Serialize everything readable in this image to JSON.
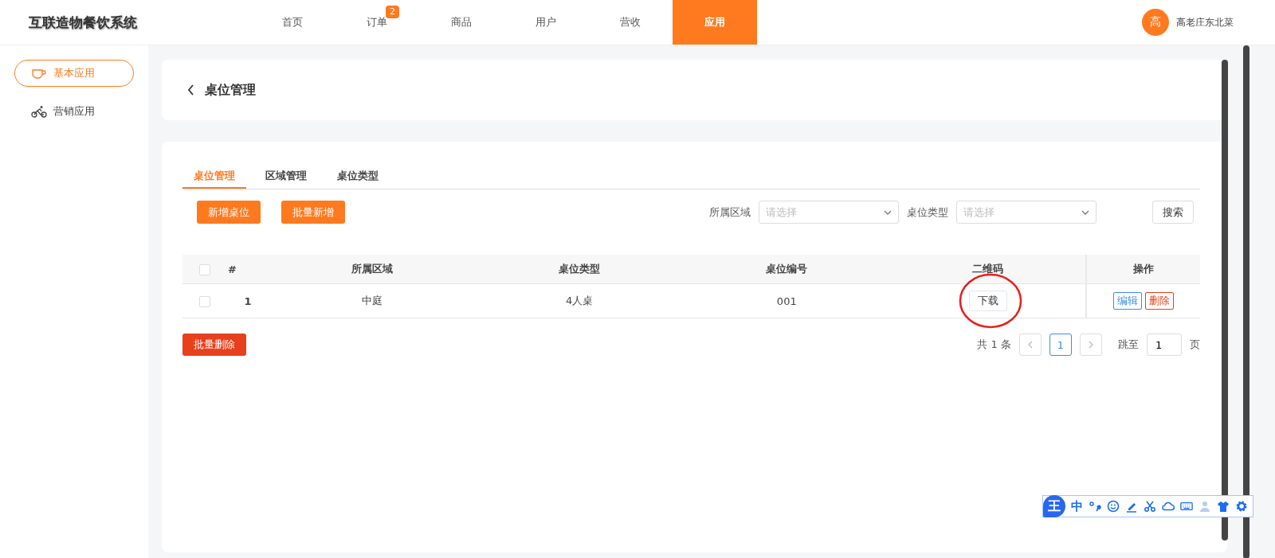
{
  "brand": "互联造物餐饮系统",
  "nav": [
    {
      "label": "首页",
      "selected": false
    },
    {
      "label": "订单",
      "selected": false,
      "badge": "2"
    },
    {
      "label": "商品",
      "selected": false
    },
    {
      "label": "用户",
      "selected": false
    },
    {
      "label": "营收",
      "selected": false
    },
    {
      "label": "应用",
      "selected": true
    }
  ],
  "user": {
    "avatar": "高",
    "name": "高老庄东北菜"
  },
  "sidebar": {
    "items": [
      {
        "label": "基本应用",
        "selected": true,
        "kind": "cup"
      },
      {
        "label": "营销应用",
        "selected": false,
        "kind": "bike"
      }
    ]
  },
  "page_title": "桌位管理",
  "tabs": [
    {
      "label": "桌位管理",
      "selected": true
    },
    {
      "label": "区域管理",
      "selected": false
    },
    {
      "label": "桌位类型",
      "selected": false
    }
  ],
  "actions": [
    "新增桌位",
    "批量新增"
  ],
  "filters": [
    {
      "label": "所属区域",
      "placeholder": "请选择"
    },
    {
      "label": "桌位类型",
      "placeholder": "请选择"
    }
  ],
  "search_button": "搜索",
  "table": {
    "select_all_checked": false,
    "columns": [
      "#",
      "所属区域",
      "桌位类型",
      "桌位编号",
      "二维码",
      "操作"
    ],
    "rows": [
      {
        "checked": false,
        "index": "1",
        "area": "中庭",
        "type": "4人桌",
        "number": "001",
        "qr": "下载",
        "edit": "编辑",
        "delete": "删除"
      }
    ]
  },
  "bulk_delete": "批量删除",
  "pagination": {
    "total": "共 1 条",
    "pages": [
      {
        "label": "1",
        "selected": true
      }
    ],
    "jump_label": "跳至",
    "jump_value": "1",
    "page_unit": "页"
  },
  "ime_toolbar": {
    "logo": "王",
    "mode": "中"
  }
}
